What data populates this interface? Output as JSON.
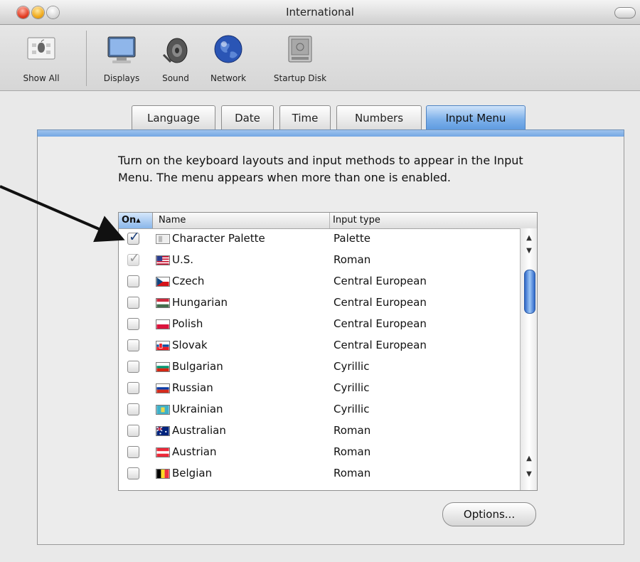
{
  "window": {
    "title": "International"
  },
  "toolbar": {
    "items": [
      {
        "label": "Show All",
        "icon": "apple-show-all-icon"
      },
      {
        "label": "Displays",
        "icon": "display-icon"
      },
      {
        "label": "Sound",
        "icon": "speaker-icon"
      },
      {
        "label": "Network",
        "icon": "globe-icon"
      },
      {
        "label": "Startup Disk",
        "icon": "disk-icon"
      }
    ]
  },
  "tabs": [
    {
      "label": "Language",
      "active": false
    },
    {
      "label": "Date",
      "active": false
    },
    {
      "label": "Time",
      "active": false
    },
    {
      "label": "Numbers",
      "active": false
    },
    {
      "label": "Input Menu",
      "active": true
    }
  ],
  "description": "Turn on the keyboard layouts and input methods to appear in the Input Menu. The menu appears when more than one is enabled.",
  "list": {
    "columns": {
      "on": "On",
      "on_sort_glyph": "▲",
      "name": "Name",
      "input_type": "Input type"
    },
    "rows": [
      {
        "name": "Character Palette",
        "type": "Palette",
        "checked": true,
        "disabled": false,
        "flag": "palette-icon"
      },
      {
        "name": "U.S.",
        "type": "Roman",
        "checked": true,
        "disabled": true,
        "flag": "us-flag-icon"
      },
      {
        "name": "Czech",
        "type": "Central European",
        "checked": false,
        "disabled": false,
        "flag": "czech-flag-icon"
      },
      {
        "name": "Hungarian",
        "type": "Central European",
        "checked": false,
        "disabled": false,
        "flag": "hungarian-flag-icon"
      },
      {
        "name": "Polish",
        "type": "Central European",
        "checked": false,
        "disabled": false,
        "flag": "polish-flag-icon"
      },
      {
        "name": "Slovak",
        "type": "Central European",
        "checked": false,
        "disabled": false,
        "flag": "slovak-flag-icon"
      },
      {
        "name": "Bulgarian",
        "type": "Cyrillic",
        "checked": false,
        "disabled": false,
        "flag": "bulgarian-flag-icon"
      },
      {
        "name": "Russian",
        "type": "Cyrillic",
        "checked": false,
        "disabled": false,
        "flag": "russian-flag-icon"
      },
      {
        "name": "Ukrainian",
        "type": "Cyrillic",
        "checked": false,
        "disabled": false,
        "flag": "ukrainian-flag-icon"
      },
      {
        "name": "Australian",
        "type": "Roman",
        "checked": false,
        "disabled": false,
        "flag": "australian-flag-icon"
      },
      {
        "name": "Austrian",
        "type": "Roman",
        "checked": false,
        "disabled": false,
        "flag": "austrian-flag-icon"
      },
      {
        "name": "Belgian",
        "type": "Roman",
        "checked": false,
        "disabled": false,
        "flag": "belgian-flag-icon"
      }
    ]
  },
  "options_button": {
    "label": "Options..."
  },
  "colors": {
    "accent": "#6fa3e2",
    "tab_active": "#7eb1ea",
    "scroll_thumb": "#2f68c9"
  }
}
